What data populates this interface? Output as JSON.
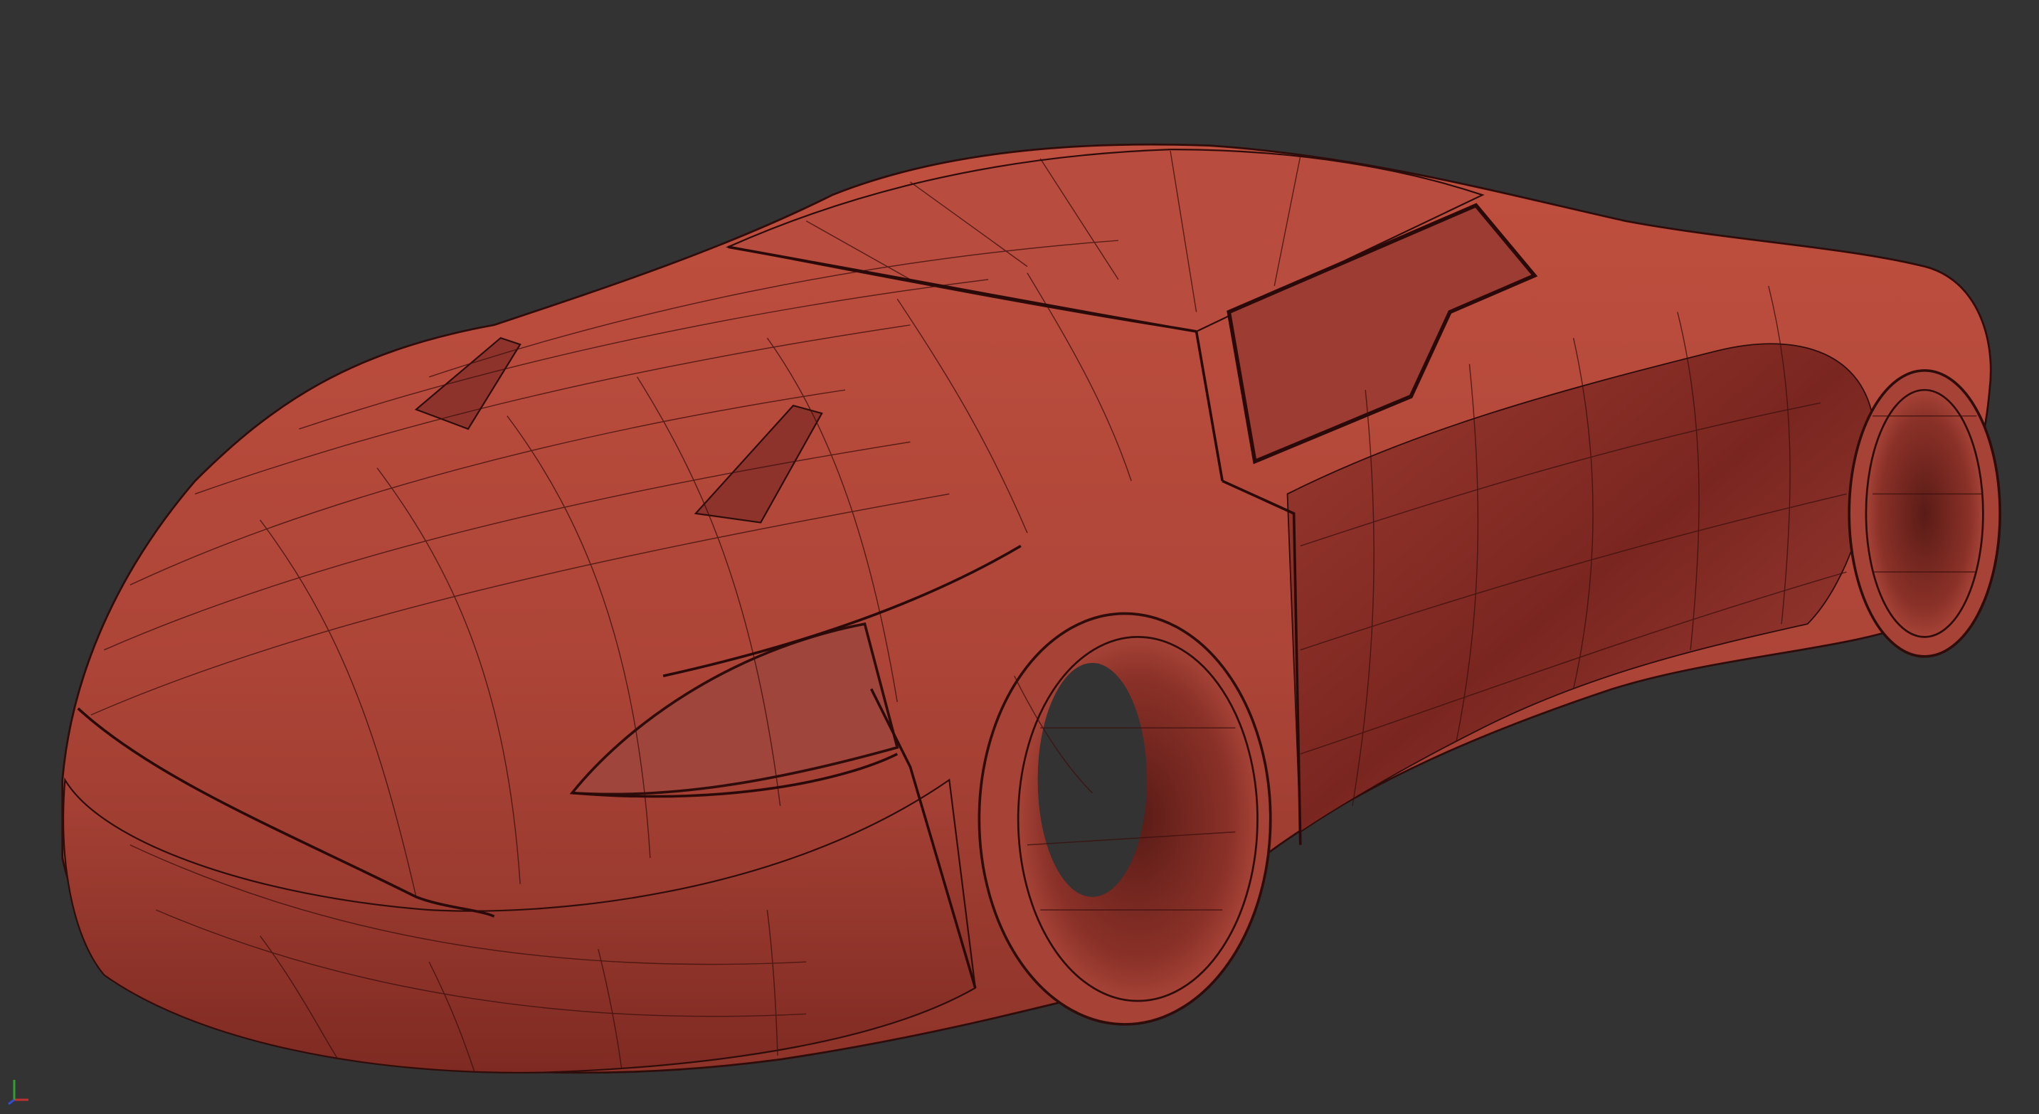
{
  "viewport": {
    "background_color": "#333333",
    "shading_mode": "wireframe-on-shaded",
    "model": {
      "name": "sports-car-body",
      "base_color": "#b0473c",
      "shadow_color": "#6e1f1a",
      "highlight_color": "#c55a4c",
      "wire_color": "#3a0f0c"
    },
    "axis_gizmo": {
      "x_color": "#c03030",
      "y_color": "#30a030",
      "z_color": "#3050d0"
    }
  }
}
